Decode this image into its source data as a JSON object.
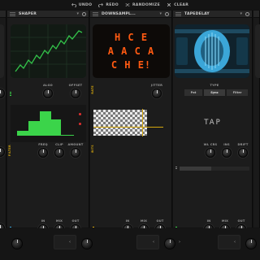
{
  "toolbar": {
    "undo": "UNDO",
    "redo": "REDO",
    "randomize": "RANDOMIZE",
    "clear": "CLEAR"
  },
  "modules": [
    {
      "title": "SHAPER",
      "knobs_top": [
        "ALGO",
        "OFFSET"
      ],
      "knobs_mid": [
        "FREQ",
        "CLIP",
        "AMOUNT"
      ],
      "knobs_bottom": [
        "IN",
        "MIX",
        "OUT"
      ],
      "side_labels": [
        "MODE",
        "FILTER"
      ]
    },
    {
      "title": "DOWNSAMPL...",
      "screen_text": [
        "H C E",
        "A A C A",
        "C H E!"
      ],
      "knobs_top": [
        "JITTER"
      ],
      "knobs_bottom": [
        "IN",
        "MIX",
        "OUT"
      ]
    },
    {
      "title": "TAPEDELAY",
      "type_label": "TYPE",
      "type_options": [
        "Pat",
        "Sync",
        "Filter"
      ],
      "big_label": "TAP",
      "knobs_mid": [
        "WL CRS",
        "INS",
        "DRIFT"
      ],
      "knobs_bottom": [
        "IN",
        "MIX",
        "OUT"
      ]
    }
  ],
  "colors": {
    "accent_green": "#3bd44a",
    "accent_yellow": "#d4a60d",
    "screen_orange": "#ff5a12",
    "tape_blue": "#3ba6d8"
  }
}
